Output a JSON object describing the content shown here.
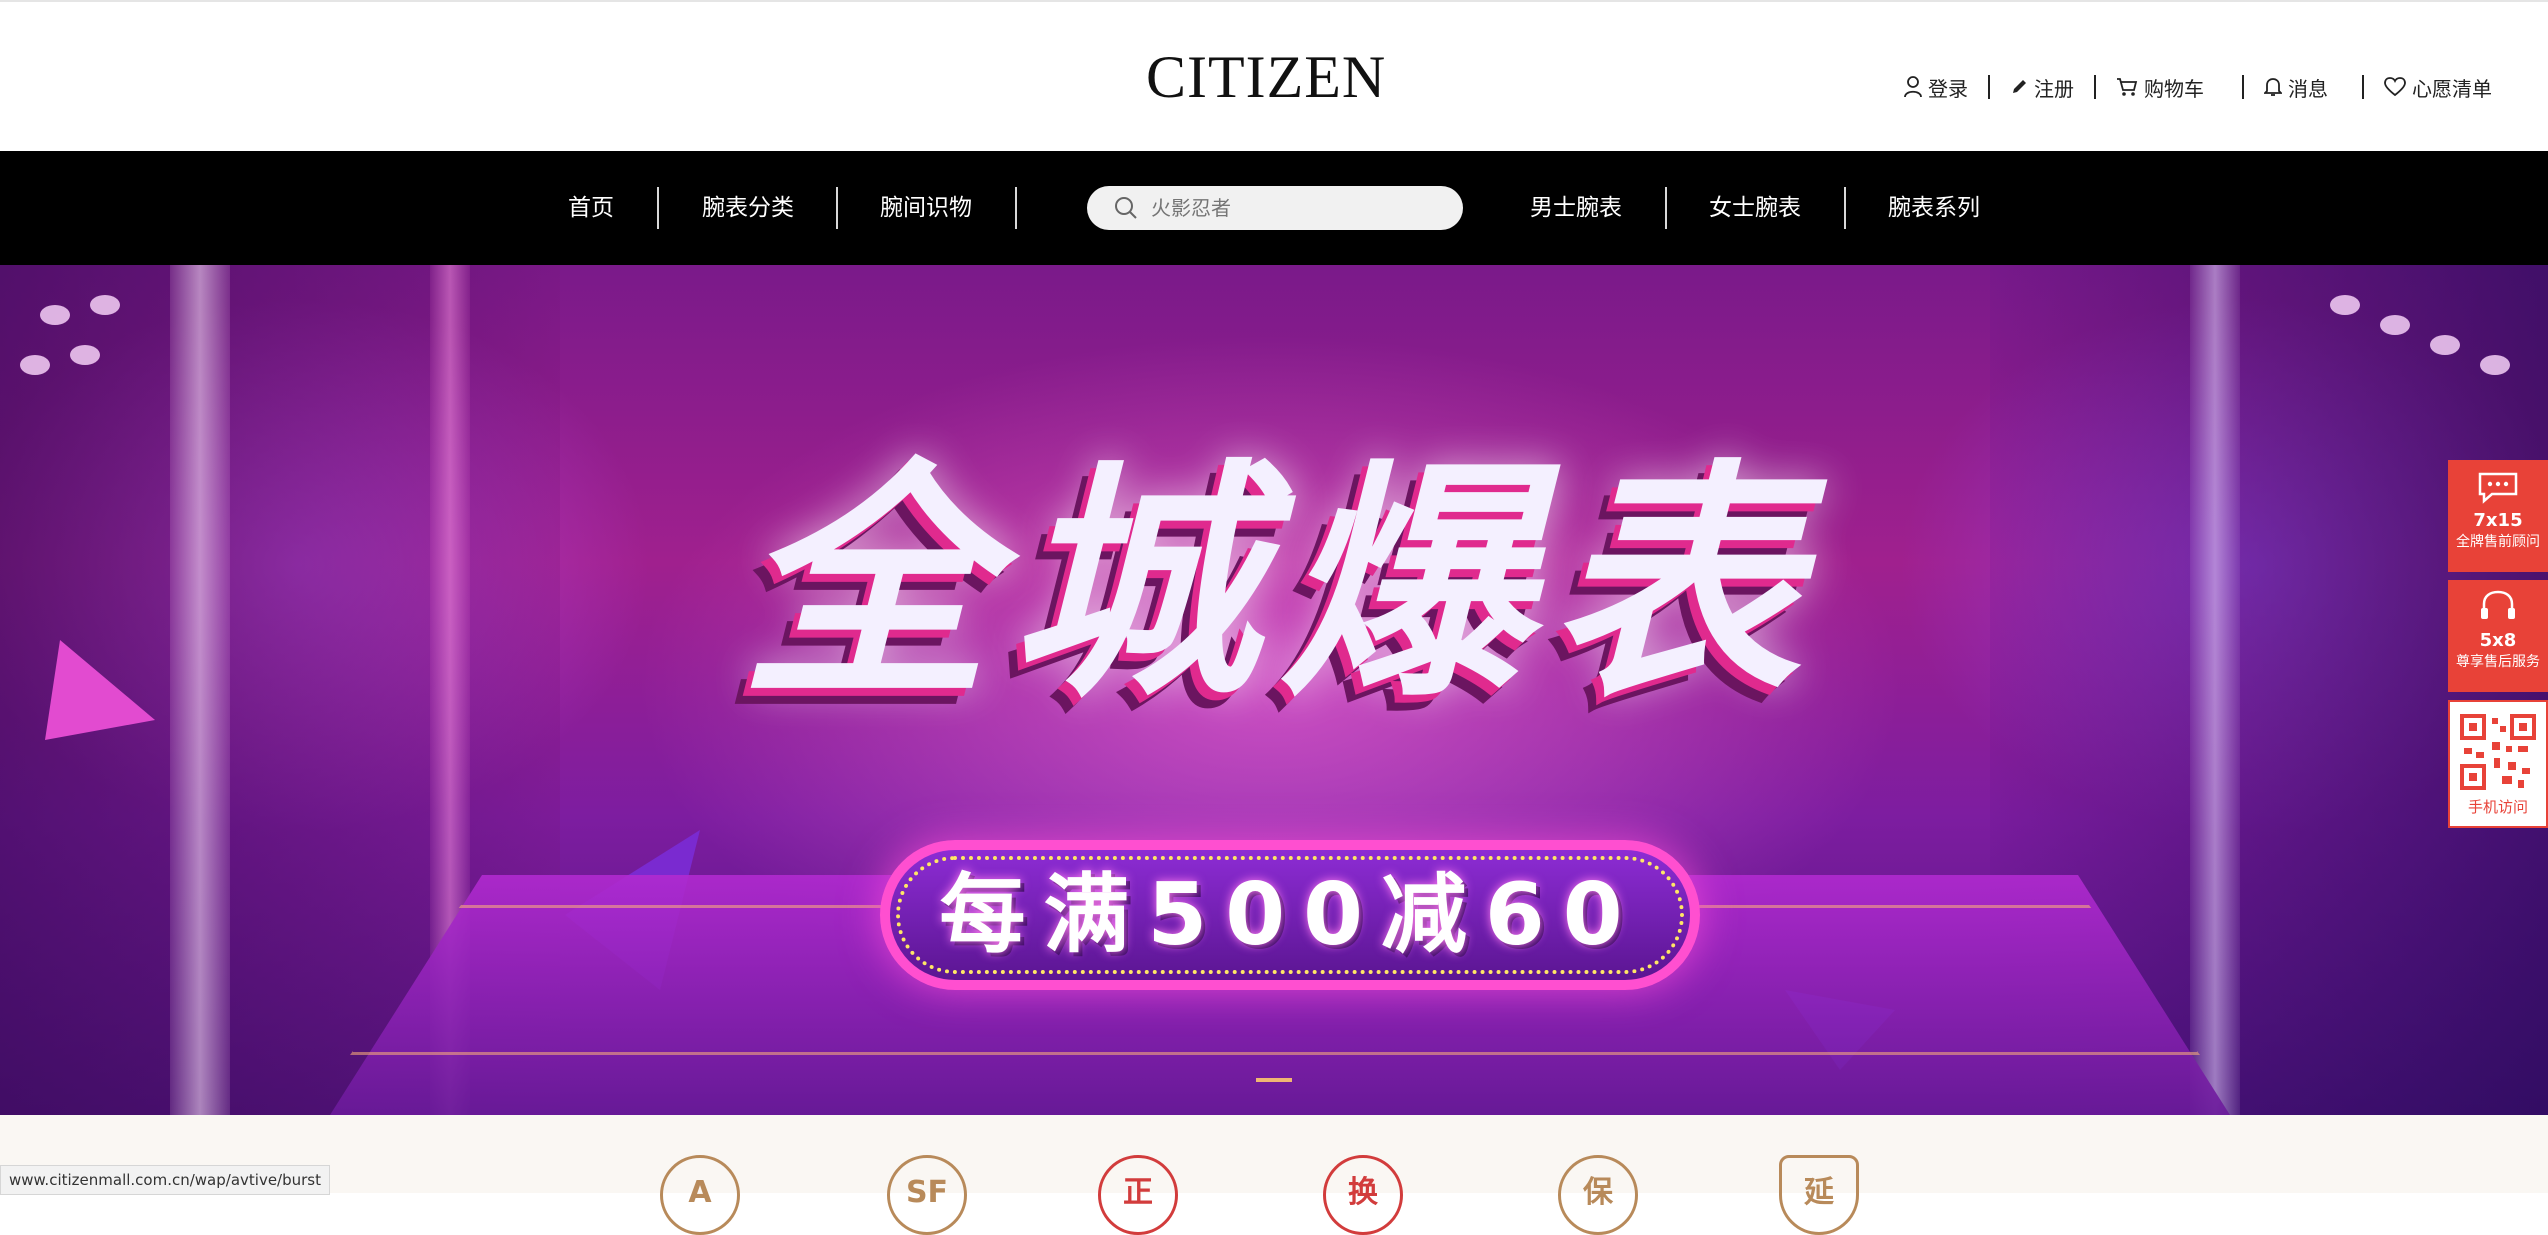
{
  "header": {
    "logo": "CITIZEN",
    "links": {
      "login": "登录",
      "register": "注册",
      "cart": "购物车",
      "messages": "消息",
      "wishlist": "心愿清单"
    }
  },
  "nav": {
    "items": [
      "首页",
      "腕表分类",
      "腕间识物",
      "男士腕表",
      "女士腕表",
      "腕表系列"
    ],
    "search_placeholder": "火影忍者"
  },
  "banner": {
    "headline": "全城爆表",
    "promo": "每满500减60",
    "active_slide": 1
  },
  "side": {
    "consult_num": "7x15",
    "consult_label": "全牌售前顾问",
    "service_num": "5x8",
    "service_label": "尊享售后服务",
    "mobile_label": "手机访问"
  },
  "features": [
    "A",
    "SF",
    "正",
    "换",
    "保",
    "延"
  ],
  "status_url": "www.citizenmall.com.cn/wap/avtive/burst",
  "colors": {
    "nav_bg": "#000000",
    "accent_red": "#e84238",
    "gold": "#b88a5a"
  }
}
